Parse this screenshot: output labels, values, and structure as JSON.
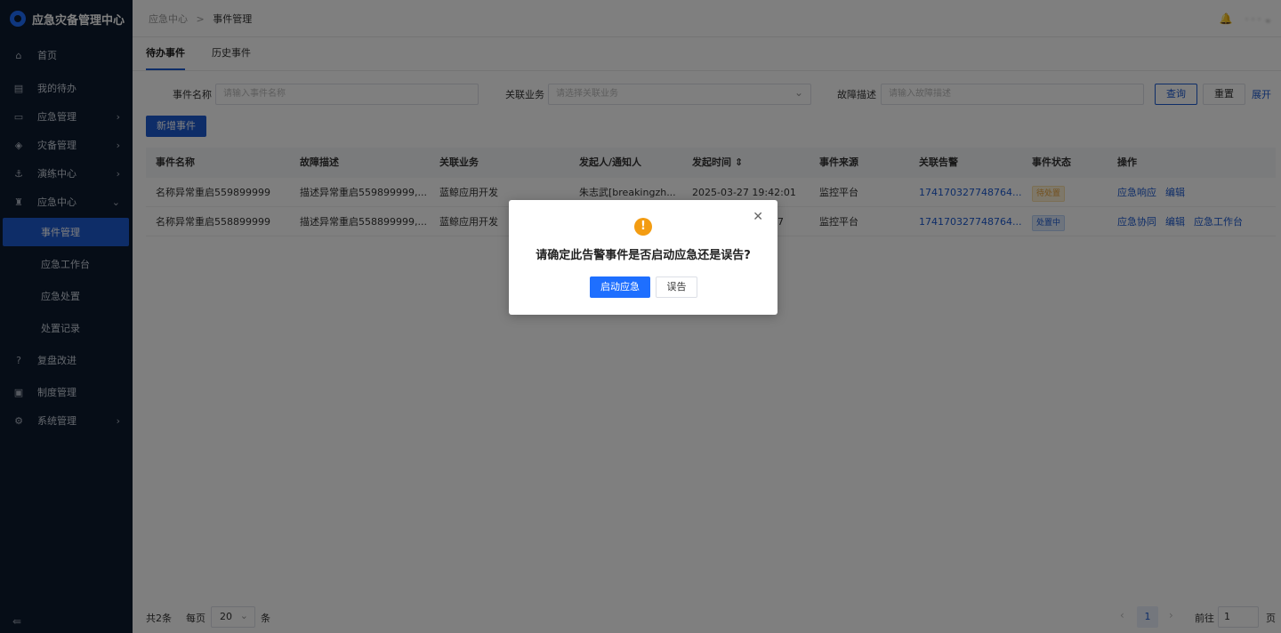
{
  "app": {
    "title": "应急灾备管理中心"
  },
  "sidebar": {
    "items": [
      {
        "label": "首页",
        "icon": "home-icon",
        "glyph": "⌂"
      },
      {
        "label": "我的待办",
        "icon": "calendar-icon",
        "glyph": "▤"
      },
      {
        "label": "应急管理",
        "icon": "monitor-icon",
        "glyph": "▭",
        "arrow": "›"
      },
      {
        "label": "灾备管理",
        "icon": "layers-icon",
        "glyph": "◈",
        "arrow": "›"
      },
      {
        "label": "演练中心",
        "icon": "drill-icon",
        "glyph": "⚓",
        "arrow": "›"
      },
      {
        "label": "应急中心",
        "icon": "emergency-icon",
        "glyph": "♜",
        "arrow": "⌄"
      }
    ],
    "sub_items": [
      {
        "label": "事件管理",
        "active": true
      },
      {
        "label": "应急工作台"
      },
      {
        "label": "应急处置"
      },
      {
        "label": "处置记录"
      }
    ],
    "items_after": [
      {
        "label": "复盘改进",
        "icon": "help-circle-icon",
        "glyph": "?"
      },
      {
        "label": "制度管理",
        "icon": "document-icon",
        "glyph": "▣"
      },
      {
        "label": "系统管理",
        "icon": "settings-icon",
        "glyph": "⚙",
        "arrow": "›"
      }
    ],
    "collapse_glyph": "⇚"
  },
  "header": {
    "breadcrumb": [
      "应急中心",
      "事件管理"
    ],
    "breadcrumb_sep": ">",
    "bell_glyph": "🔔",
    "user": "· · · ⌄"
  },
  "tabs": [
    "待办事件",
    "历史事件"
  ],
  "filters": {
    "name_label": "事件名称",
    "name_placeholder": "请输入事件名称",
    "business_label": "关联业务",
    "business_placeholder": "请选择关联业务",
    "desc_label": "故障描述",
    "desc_placeholder": "请输入故障描述",
    "query": "查询",
    "reset": "重置",
    "expand": "展开"
  },
  "add_button": "新增事件",
  "table": {
    "columns": [
      "事件名称",
      "故障描述",
      "关联业务",
      "发起人/通知人",
      "发起时间 ⇕",
      "事件来源",
      "关联告警",
      "事件状态",
      "操作"
    ],
    "rows": [
      {
        "name": "名称异常重启559899999",
        "desc": "描述异常重启559899999,...",
        "business": "蓝鲸应用开发",
        "initiator": "朱志武[breakingzh...",
        "time": "2025-03-27 19:42:01",
        "source": "监控平台",
        "alert": "174170327748764...",
        "status": "待处置",
        "ops": [
          "应急响应",
          "编辑"
        ]
      },
      {
        "name": "名称异常重启558899999",
        "desc": "描述异常重启558899999,...",
        "business": "蓝鲸应用开发",
        "initiator": "",
        "time": "7",
        "source": "监控平台",
        "alert": "174170327748764...",
        "status": "处置中",
        "ops": [
          "应急协同",
          "编辑",
          "应急工作台"
        ]
      }
    ]
  },
  "pager": {
    "total": "共2条",
    "per_page_label": "每页",
    "per_page": "20",
    "unit": "条",
    "prev": "‹",
    "current": "1",
    "next": "›",
    "goto_label": "前往",
    "goto_value": "1",
    "page_unit": "页"
  },
  "modal": {
    "icon": "warning-icon",
    "icon_glyph": "!",
    "message": "请确定此告警事件是否启动应急还是误告?",
    "confirm": "启动应急",
    "cancel": "误告",
    "close_glyph": "✕"
  },
  "colors": {
    "sidebar_bg": "#0d1a2e",
    "primary": "#1d5ad0",
    "modal_primary": "#1e6fff",
    "warning": "#f39c12"
  }
}
